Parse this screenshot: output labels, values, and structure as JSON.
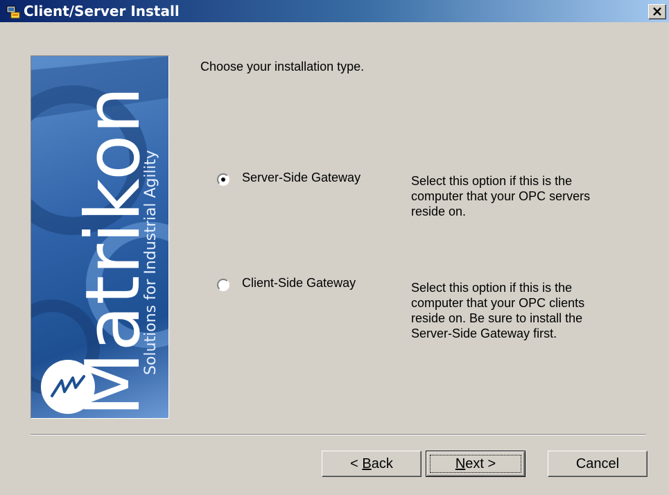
{
  "window": {
    "title": "Client/Server Install",
    "close_symbol": "×"
  },
  "banner": {
    "brand": "Matrikon",
    "tagline": "Solutions for Industrial Agility"
  },
  "content": {
    "instruction": "Choose your installation type.",
    "options": [
      {
        "label": "Server-Side Gateway",
        "selected": true,
        "description": "Select this option if this is the computer that your OPC servers reside on."
      },
      {
        "label": "Client-Side Gateway",
        "selected": false,
        "description": "Select this option if this is the computer that your OPC clients reside on. Be sure to install the Server-Side Gateway first."
      }
    ]
  },
  "buttons": {
    "back_prefix": "< ",
    "back_mnemonic": "B",
    "back_rest": "ack",
    "next_mnemonic": "N",
    "next_rest": "ext >",
    "cancel": "Cancel"
  },
  "icons": {
    "title_icon": "installer-icon",
    "logo_icon": "matrikon-logo-icon",
    "close_icon": "close-icon"
  }
}
